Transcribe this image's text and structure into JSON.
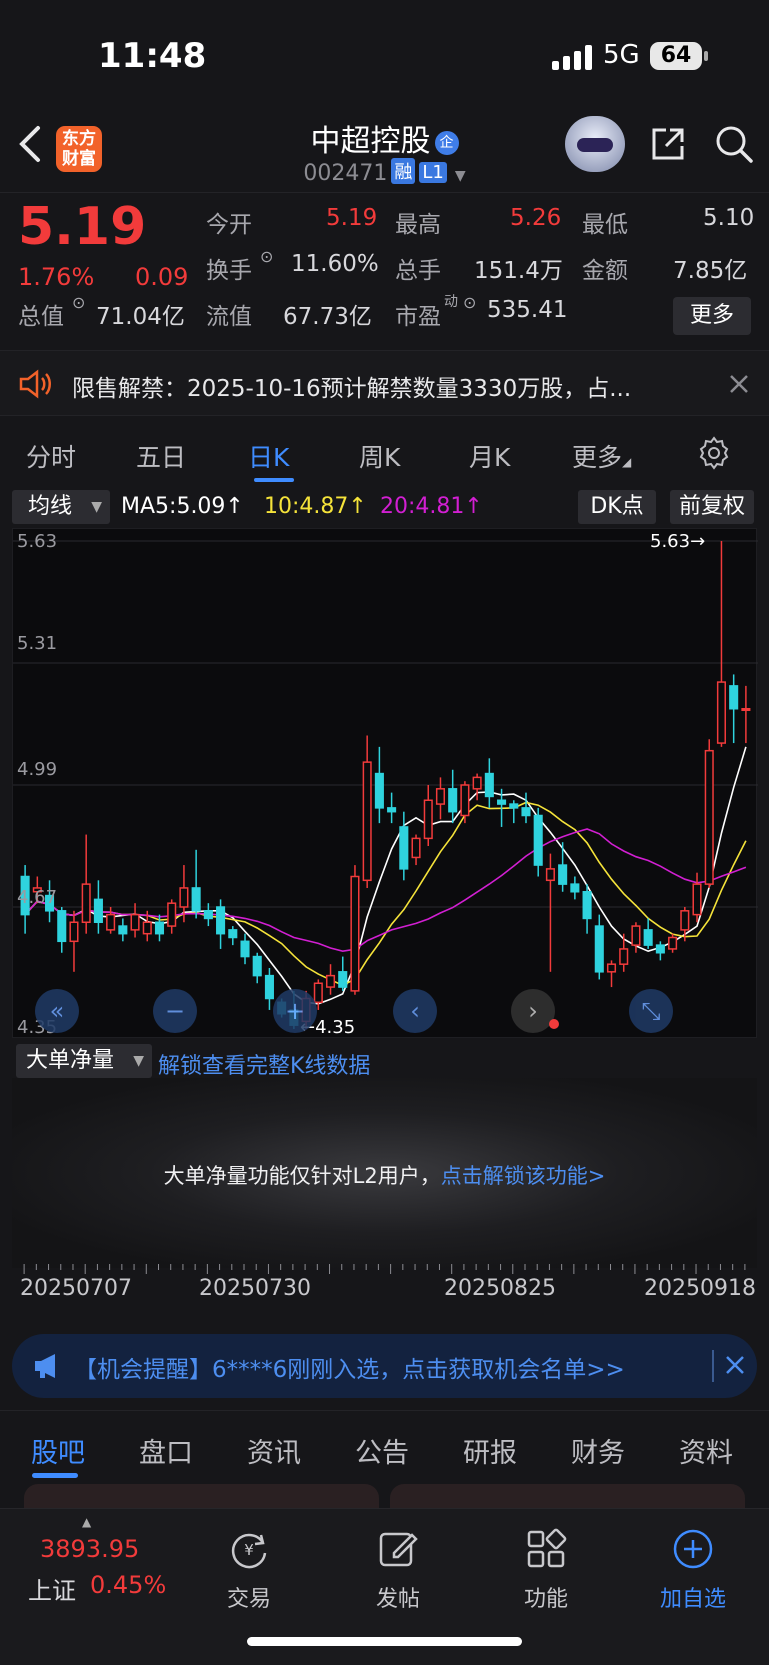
{
  "status": {
    "time": "11:48",
    "network": "5G",
    "battery": "64"
  },
  "header": {
    "name": "中超控股",
    "badge_qi": "企",
    "code": "002471",
    "tag_rong": "融",
    "tag_l1": "L1",
    "logo_line1": "东方",
    "logo_line2": "财富"
  },
  "quote": {
    "price": "5.19",
    "pct": "1.76%",
    "change": "0.09",
    "open_label": "今开",
    "open": "5.19",
    "high_label": "最高",
    "high": "5.26",
    "low_label": "最低",
    "low": "5.10",
    "turnover_label": "换手",
    "turnover": "11.60%",
    "volume_label": "总手",
    "volume": "151.4万",
    "amount_label": "金额",
    "amount": "7.85亿",
    "mktcap_label": "总值",
    "mktcap": "71.04亿",
    "float_label": "流值",
    "float": "67.73亿",
    "pe_label": "市盈",
    "pe_sup": "动",
    "pe": "535.41",
    "more": "更多"
  },
  "notice": {
    "text": "限售解禁：2025-10-16预计解禁数量3330万股，占..."
  },
  "ktabs": [
    "分时",
    "五日",
    "日K",
    "周K",
    "月K",
    "更多"
  ],
  "ma": {
    "selector": "均线",
    "ma5": "MA5:5.09↑",
    "ma10": "10:4.87↑",
    "ma20": "20:4.81↑",
    "dk": "DK点",
    "adjust": "前复权",
    "colors": {
      "ma5": "#ffffff",
      "ma10": "#f5e33a",
      "ma20": "#d21fd2"
    }
  },
  "chart_data": {
    "type": "candlestick",
    "ylim": [
      4.35,
      5.63
    ],
    "y_ticks": [
      "5.63",
      "5.31",
      "4.99",
      "4.67",
      "4.35"
    ],
    "max_label": "5.63→",
    "min_label": "←4.35",
    "colors": {
      "up": "#f23b3b",
      "down": "#2fd3de"
    },
    "candles": [
      [
        4.75,
        4.65,
        4.78,
        4.6
      ],
      [
        4.71,
        4.72,
        4.75,
        4.68
      ],
      [
        4.7,
        4.66,
        4.74,
        4.63
      ],
      [
        4.66,
        4.58,
        4.67,
        4.55
      ],
      [
        4.58,
        4.63,
        4.66,
        4.5
      ],
      [
        4.63,
        4.73,
        4.86,
        4.6
      ],
      [
        4.69,
        4.63,
        4.74,
        4.6
      ],
      [
        4.61,
        4.65,
        4.67,
        4.6
      ],
      [
        4.62,
        4.6,
        4.64,
        4.58
      ],
      [
        4.61,
        4.65,
        4.68,
        4.59
      ],
      [
        4.6,
        4.63,
        4.66,
        4.58
      ],
      [
        4.63,
        4.6,
        4.65,
        4.58
      ],
      [
        4.62,
        4.68,
        4.69,
        4.6
      ],
      [
        4.67,
        4.72,
        4.78,
        4.63
      ],
      [
        4.72,
        4.66,
        4.82,
        4.64
      ],
      [
        4.66,
        4.64,
        4.68,
        4.62
      ],
      [
        4.67,
        4.6,
        4.69,
        4.56
      ],
      [
        4.61,
        4.59,
        4.62,
        4.57
      ],
      [
        4.58,
        4.54,
        4.6,
        4.52
      ],
      [
        4.54,
        4.49,
        4.55,
        4.47
      ],
      [
        4.49,
        4.43,
        4.51,
        4.4
      ],
      [
        4.42,
        4.39,
        4.43,
        4.38
      ],
      [
        4.4,
        4.36,
        4.45,
        4.35
      ],
      [
        4.37,
        4.43,
        4.45,
        4.35
      ],
      [
        4.42,
        4.47,
        4.48,
        4.4
      ],
      [
        4.46,
        4.49,
        4.52,
        4.44
      ],
      [
        4.5,
        4.46,
        4.54,
        4.45
      ],
      [
        4.45,
        4.75,
        4.78,
        4.44
      ],
      [
        4.74,
        5.05,
        5.12,
        4.72
      ],
      [
        5.02,
        4.93,
        5.09,
        4.89
      ],
      [
        4.93,
        4.92,
        4.97,
        4.89
      ],
      [
        4.88,
        4.77,
        4.92,
        4.74
      ],
      [
        4.8,
        4.85,
        4.86,
        4.78
      ],
      [
        4.85,
        4.95,
        4.99,
        4.83
      ],
      [
        4.94,
        4.98,
        5.01,
        4.9
      ],
      [
        4.98,
        4.92,
        5.03,
        4.89
      ],
      [
        4.91,
        4.99,
        5.0,
        4.89
      ],
      [
        4.98,
        5.01,
        5.02,
        4.95
      ],
      [
        5.02,
        4.96,
        5.06,
        4.93
      ],
      [
        4.95,
        4.94,
        4.98,
        4.88
      ],
      [
        4.94,
        4.93,
        4.95,
        4.89
      ],
      [
        4.93,
        4.91,
        4.97,
        4.89
      ],
      [
        4.91,
        4.78,
        4.93,
        4.75
      ],
      [
        4.74,
        4.77,
        4.81,
        4.5
      ],
      [
        4.78,
        4.73,
        4.84,
        4.71
      ],
      [
        4.73,
        4.71,
        4.75,
        4.69
      ],
      [
        4.71,
        4.64,
        4.73,
        4.6
      ],
      [
        4.62,
        4.5,
        4.65,
        4.48
      ],
      [
        4.5,
        4.52,
        4.53,
        4.46
      ],
      [
        4.52,
        4.56,
        4.6,
        4.5
      ],
      [
        4.57,
        4.62,
        4.63,
        4.55
      ],
      [
        4.61,
        4.57,
        4.64,
        4.56
      ],
      [
        4.57,
        4.55,
        4.58,
        4.53
      ],
      [
        4.56,
        4.59,
        4.6,
        4.55
      ],
      [
        4.61,
        4.66,
        4.67,
        4.58
      ],
      [
        4.65,
        4.73,
        4.76,
        4.63
      ],
      [
        4.73,
        5.08,
        5.11,
        4.72
      ],
      [
        5.1,
        5.26,
        5.63,
        5.09
      ],
      [
        5.25,
        5.19,
        5.28,
        5.1
      ],
      [
        5.19,
        5.19,
        5.25,
        5.1
      ]
    ]
  },
  "nav_buttons": [
    "«",
    "−",
    "+",
    "‹",
    "›",
    "⤡"
  ],
  "ddjl": {
    "selector": "大单净量",
    "link": "解锁查看完整K线数据",
    "msg": "大单净量功能仅针对L2用户，",
    "msg_link": "点击解锁该功能>"
  },
  "dates": [
    "20250707",
    "20250730",
    "20250825",
    "20250918"
  ],
  "promo": {
    "text": "【机会提醒】6****6刚刚入选，点击获取机会名单>>"
  },
  "btabs": [
    "股吧",
    "盘口",
    "资讯",
    "公告",
    "研报",
    "财务",
    "资料"
  ],
  "bottom_nav": {
    "index_value": "3893.95",
    "index_name": "上证",
    "index_pct": "0.45%",
    "trade": "交易",
    "post": "发帖",
    "func": "功能",
    "add": "加自选"
  }
}
